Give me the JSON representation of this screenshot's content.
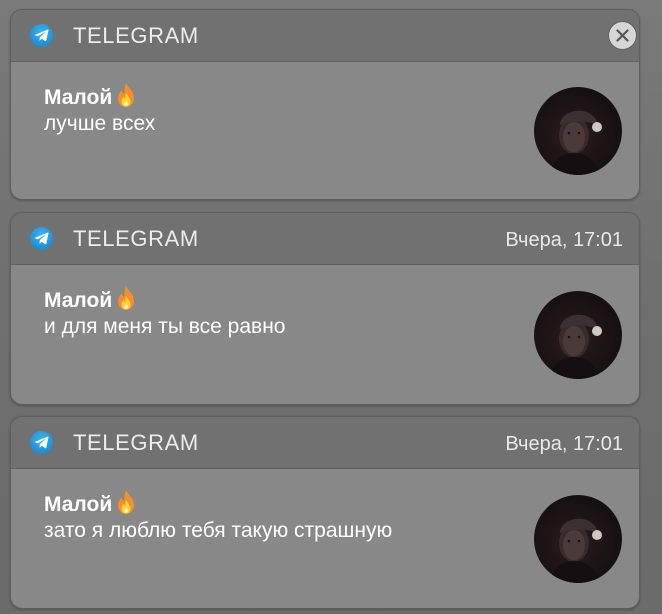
{
  "notifications": [
    {
      "app_name": "TELEGRAM",
      "timestamp": "",
      "has_close": true,
      "sender": "Малой",
      "sender_emoji": "fire-emoji",
      "message": "лучше всех",
      "avatar": "avatar-photo"
    },
    {
      "app_name": "TELEGRAM",
      "timestamp": "Вчера, 17:01",
      "has_close": false,
      "sender": "Малой",
      "sender_emoji": "fire-emoji",
      "message": "и для меня ты все равно",
      "avatar": "avatar-photo"
    },
    {
      "app_name": "TELEGRAM",
      "timestamp": "Вчера, 17:01",
      "has_close": false,
      "sender": "Малой",
      "sender_emoji": "fire-emoji",
      "message": "зато я люблю тебя такую страшную",
      "avatar": "avatar-photo"
    }
  ],
  "colors": {
    "telegram_blue": "#2aa3e6",
    "card_body": "#888888",
    "card_header": "#717171",
    "text": "#ffffff"
  }
}
